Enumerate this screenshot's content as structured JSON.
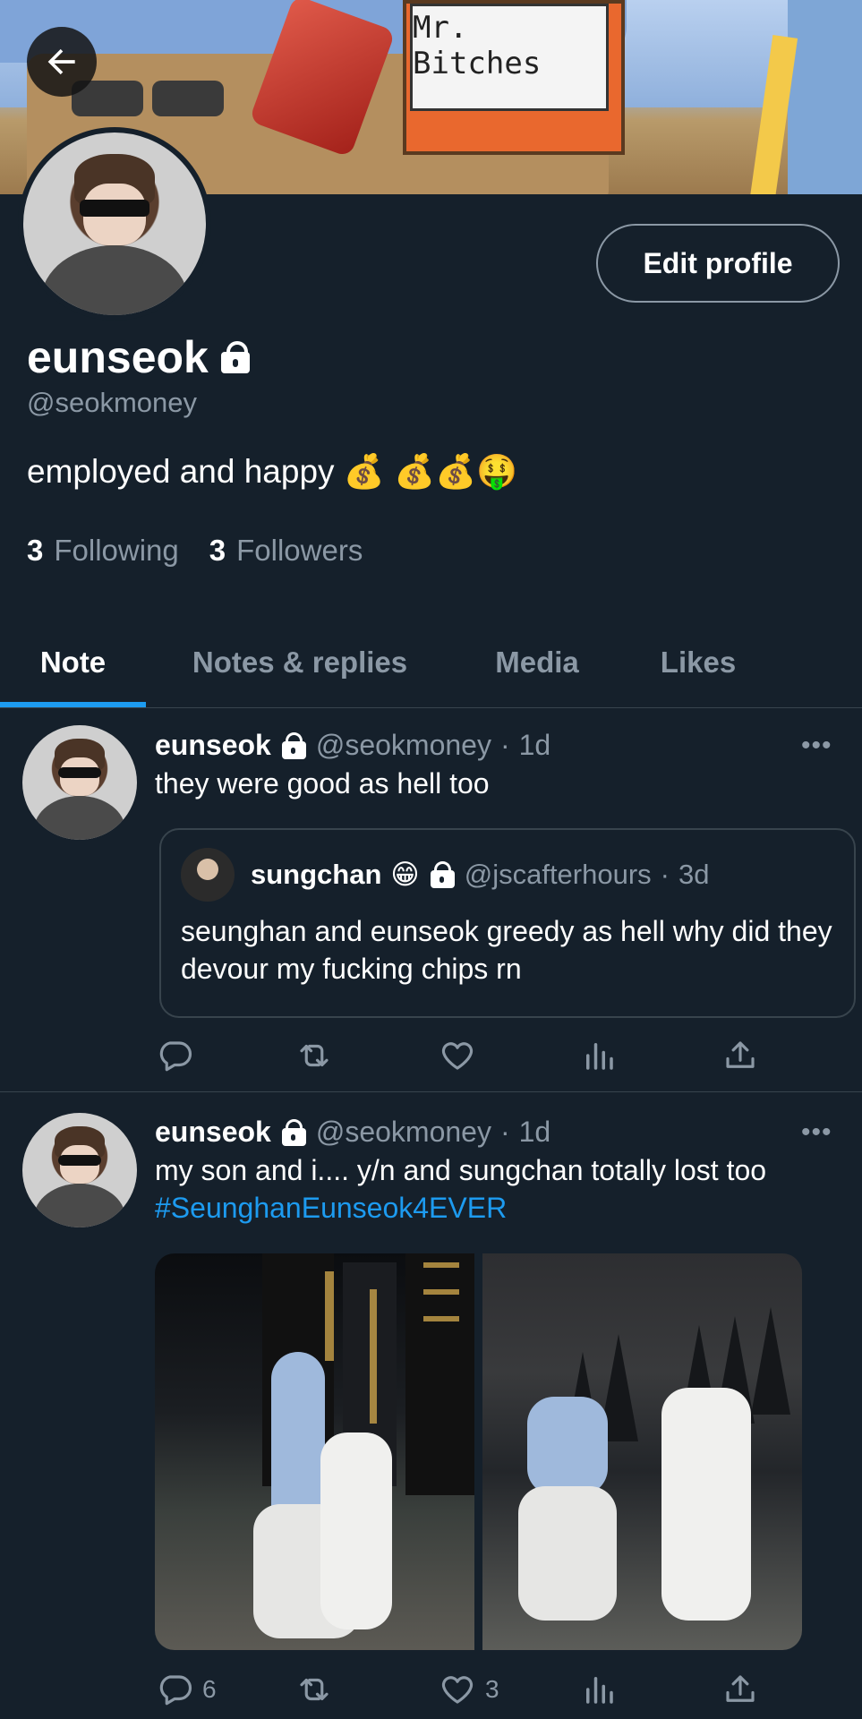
{
  "banner": {
    "sign_text": "Mr. Bitches"
  },
  "profile": {
    "display_name": "eunseok",
    "handle": "@seokmoney",
    "bio": "employed and happy 💰 💰💰🤑",
    "following_count": "3",
    "following_label": "Following",
    "followers_count": "3",
    "followers_label": "Followers",
    "edit_label": "Edit profile"
  },
  "tabs": [
    {
      "label": "Note",
      "active": true
    },
    {
      "label": "Notes & replies",
      "active": false
    },
    {
      "label": "Media",
      "active": false
    },
    {
      "label": "Likes",
      "active": false
    }
  ],
  "tweets": [
    {
      "name": "eunseok",
      "handle": "@seokmoney",
      "time": "1d",
      "text": "they were good as hell too",
      "quote": {
        "name": "sungchan",
        "emoji": "😁",
        "handle": "@jscafterhours",
        "time": "3d",
        "text": "seunghan and eunseok greedy as hell why did they devour my fucking chips rn"
      },
      "replies": "",
      "likes": ""
    },
    {
      "name": "eunseok",
      "handle": "@seokmoney",
      "time": "1d",
      "text": "my son and i.... y/n and sungchan totally lost too",
      "hashtag": "#SeunghanEunseok4EVER",
      "replies": "6",
      "likes": "3"
    }
  ],
  "colors": {
    "background": "#15202b",
    "accent": "#1d9bf0",
    "muted": "#8b98a5",
    "border": "#38444d"
  },
  "icons": [
    "back-arrow-icon",
    "lock-icon",
    "more-icon",
    "reply-icon",
    "retweet-icon",
    "like-icon",
    "analytics-icon",
    "share-icon"
  ]
}
